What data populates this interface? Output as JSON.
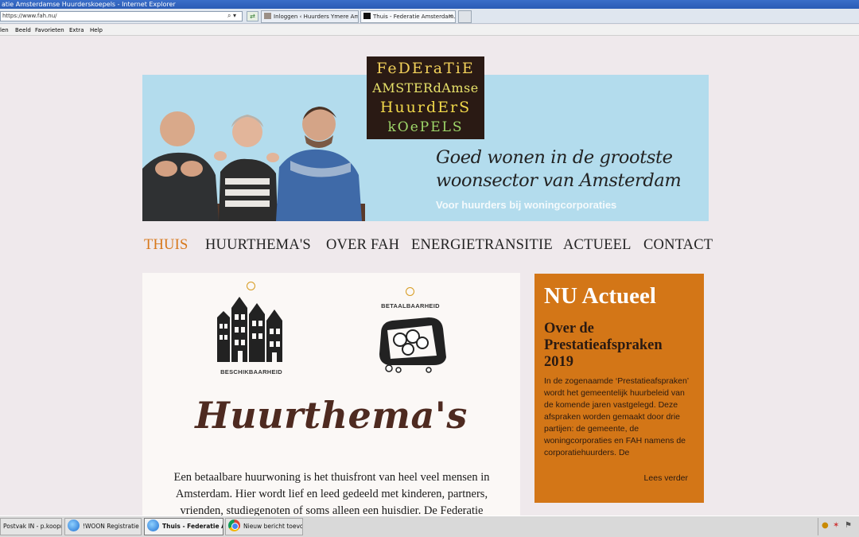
{
  "browser": {
    "window_title": "atie Amsterdamse Huurderskoepels - Internet Explorer",
    "address": "https://www.fah.nu/",
    "tabs": [
      {
        "label": "Inloggen ‹ Huurders Ymere Ams..."
      },
      {
        "label": "Thuis - Federatie Amsterdam..."
      }
    ],
    "menu": [
      "len",
      "Beeld",
      "Favorieten",
      "Extra",
      "Help"
    ]
  },
  "header": {
    "logo_lines": [
      "FeDEraTiE",
      "AMSTERdAmse",
      "HuurdErS",
      "kOePELS"
    ],
    "tagline": "Goed wonen in de grootste woonsector van Amsterdam",
    "subtagline": "Voor huurders bij woningcorporaties"
  },
  "nav": [
    {
      "label": "THUIS"
    },
    {
      "label": "HUURTHEMA'S"
    },
    {
      "label": "OVER FAH"
    },
    {
      "label": "ENERGIETRANSITIE"
    },
    {
      "label": "ACTUEEL"
    },
    {
      "label": "CONTACT"
    }
  ],
  "themes": {
    "items": [
      {
        "label": "BESCHIKBAARHEID",
        "icon": "houses-icon"
      },
      {
        "label": "BETAALBAARHEID",
        "icon": "wallet-icon"
      }
    ],
    "title": "Huurthema's",
    "intro": "Een betaalbare huurwoning is het thuisfront van heel veel mensen in Amsterdam. Hier wordt lief en leed gedeeld met kinderen, partners, vrienden, studiegenoten of soms alleen een huisdier. De Federatie"
  },
  "sidebar": {
    "heading": "NU Actueel",
    "post_title": "Over de Prestatieafspraken 2019",
    "post_excerpt": "In de zogenaamde ‘Prestatieafspraken’ wordt het gemeentelijk huurbeleid van de komende jaren vastgelegd. Deze afspraken worden gemaakt door drie partijen: de gemeente, de woningcorporaties en FAH namens de corporatiehuurders. De",
    "read_more": "Lees verder"
  },
  "taskbar": {
    "items": [
      {
        "label": "Postvak IN - p.koopm..."
      },
      {
        "label": "!WOON Registratie p..."
      },
      {
        "label": "Thuis - Federatie A..."
      },
      {
        "label": "Nieuw bericht toevoe..."
      }
    ]
  },
  "colors": {
    "accent_orange": "#d37617",
    "hero_blue": "#b3dced",
    "title_brown": "#4e2a20",
    "nav_active": "#d7771a"
  }
}
